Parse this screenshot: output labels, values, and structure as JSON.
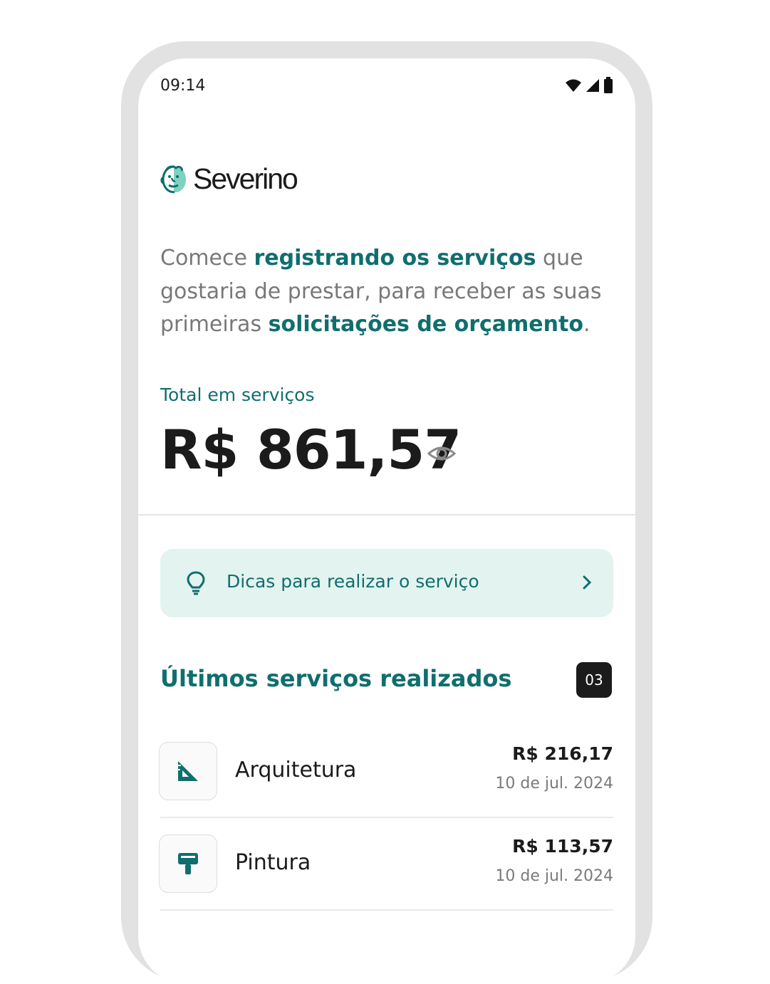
{
  "status_bar": {
    "time": "09:14",
    "icons": [
      "wifi-icon",
      "signal-icon",
      "battery-icon"
    ]
  },
  "brand": {
    "name": "Severino",
    "logo_icon": "severino-face-logo",
    "color": "#106e6e"
  },
  "intro": {
    "part1": "Comece ",
    "highlight1": "registrando os serviços",
    "part2": " que gostaria de prestar, para receber as suas primeiras ",
    "highlight2": "solicitações de orçamento",
    "part3": "."
  },
  "total": {
    "label": "Total em serviços",
    "value": "R$ 861,57",
    "toggle_icon": "eye-icon"
  },
  "tips": {
    "label": "Dicas para realizar o serviço",
    "icon": "lightbulb-icon",
    "action_icon": "chevron-right-icon",
    "background": "#e3f3ef"
  },
  "recent_services": {
    "title": "Últimos serviços realizados",
    "count": "03",
    "items": [
      {
        "name": "Arquitetura",
        "price": "R$ 216,17",
        "date": "10 de jul. 2024",
        "icon": "set-square-icon"
      },
      {
        "name": "Pintura",
        "price": "R$ 113,57",
        "date": "10 de jul. 2024",
        "icon": "paint-roller-icon"
      }
    ]
  }
}
